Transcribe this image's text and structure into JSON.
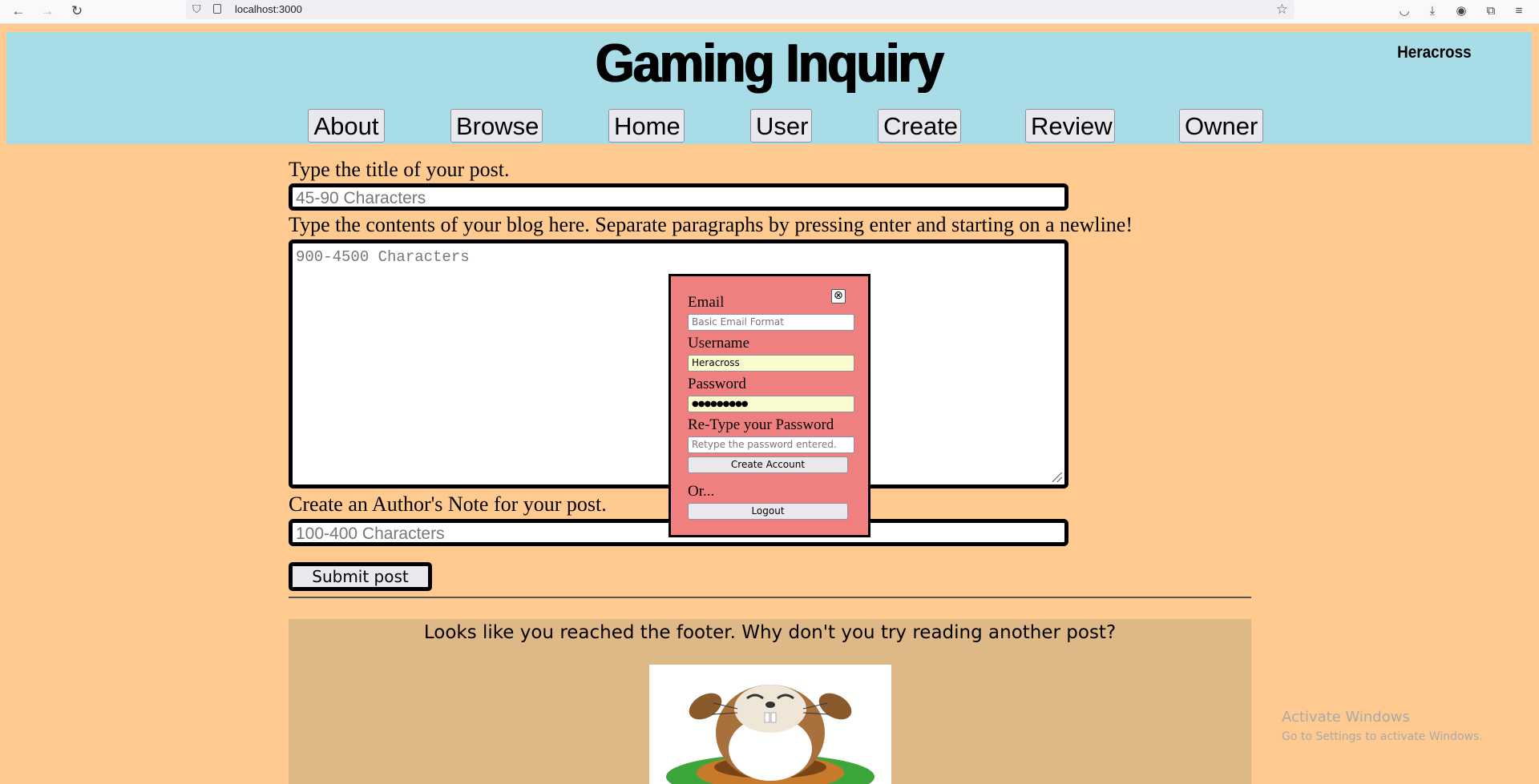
{
  "browser": {
    "url": "localhost:3000",
    "icons": [
      "back-icon",
      "forward-icon",
      "reload-icon",
      "shield-icon",
      "page-icon",
      "star-icon",
      "pocket-icon",
      "download-icon",
      "account-icon",
      "extensions-icon",
      "menu-icon"
    ]
  },
  "header": {
    "title": "Gaming Inquiry",
    "username": "Heracross",
    "nav": [
      "About",
      "Browse",
      "Home",
      "User",
      "Create",
      "Review",
      "Owner"
    ]
  },
  "form": {
    "title_label": "Type the title of your post.",
    "title_placeholder": "45-90 Characters",
    "content_label": "Type the contents of your blog here. Separate paragraphs by pressing enter and starting on a newline!",
    "content_placeholder": "900-4500 Characters",
    "note_label": "Create an Author's Note for your post.",
    "note_placeholder": "100-400 Characters",
    "submit_label": "Submit post"
  },
  "modal": {
    "close_symbol": "⊗",
    "email_label": "Email",
    "email_placeholder": "Basic Email Format",
    "username_label": "Username",
    "username_value": "Heracross",
    "password_label": "Password",
    "password_value": "●●●●●●●●●",
    "retype_label": "Re-Type your Password",
    "retype_placeholder": "Retype the password entered.",
    "create_button": "Create Account",
    "or_text": "Or...",
    "logout_button": "Logout"
  },
  "footer": {
    "text": "Looks like you reached the footer. Why don't you try reading another post?"
  },
  "watermark": {
    "title": "Activate Windows",
    "subtitle": "Go to Settings to activate Windows."
  },
  "colors": {
    "page_bg": "#ffca8f",
    "header_bg": "#a8dce6",
    "modal_bg": "#f08080",
    "footer_bg": "#deb887"
  }
}
